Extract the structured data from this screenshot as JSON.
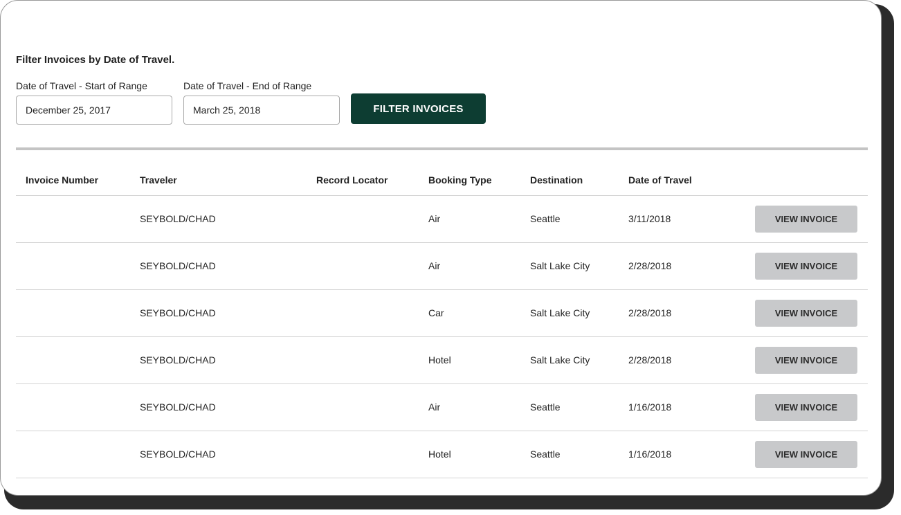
{
  "filter": {
    "heading": "Filter Invoices by Date of Travel.",
    "start_label": "Date of Travel - Start of Range",
    "start_value": "December 25, 2017",
    "end_label": "Date of Travel - End of Range",
    "end_value": "March 25, 2018",
    "button_label": "FILTER INVOICES",
    "button_color": "#0d3d32"
  },
  "table": {
    "headers": {
      "invoice_number": "Invoice Number",
      "traveler": "Traveler",
      "record_locator": "Record Locator",
      "booking_type": "Booking Type",
      "destination": "Destination",
      "date_of_travel": "Date of Travel"
    },
    "view_label": "VIEW INVOICE",
    "rows": [
      {
        "invoice_number": "",
        "traveler": "SEYBOLD/CHAD",
        "record_locator": "",
        "booking_type": "Air",
        "destination": "Seattle",
        "date": "3/11/2018"
      },
      {
        "invoice_number": "",
        "traveler": "SEYBOLD/CHAD",
        "record_locator": "",
        "booking_type": "Air",
        "destination": "Salt Lake City",
        "date": "2/28/2018"
      },
      {
        "invoice_number": "",
        "traveler": "SEYBOLD/CHAD",
        "record_locator": "",
        "booking_type": "Car",
        "destination": "Salt Lake City",
        "date": "2/28/2018"
      },
      {
        "invoice_number": "",
        "traveler": "SEYBOLD/CHAD",
        "record_locator": "",
        "booking_type": "Hotel",
        "destination": "Salt Lake City",
        "date": "2/28/2018"
      },
      {
        "invoice_number": "",
        "traveler": "SEYBOLD/CHAD",
        "record_locator": "",
        "booking_type": "Air",
        "destination": "Seattle",
        "date": "1/16/2018"
      },
      {
        "invoice_number": "",
        "traveler": "SEYBOLD/CHAD",
        "record_locator": "",
        "booking_type": "Hotel",
        "destination": "Seattle",
        "date": "1/16/2018"
      }
    ]
  }
}
